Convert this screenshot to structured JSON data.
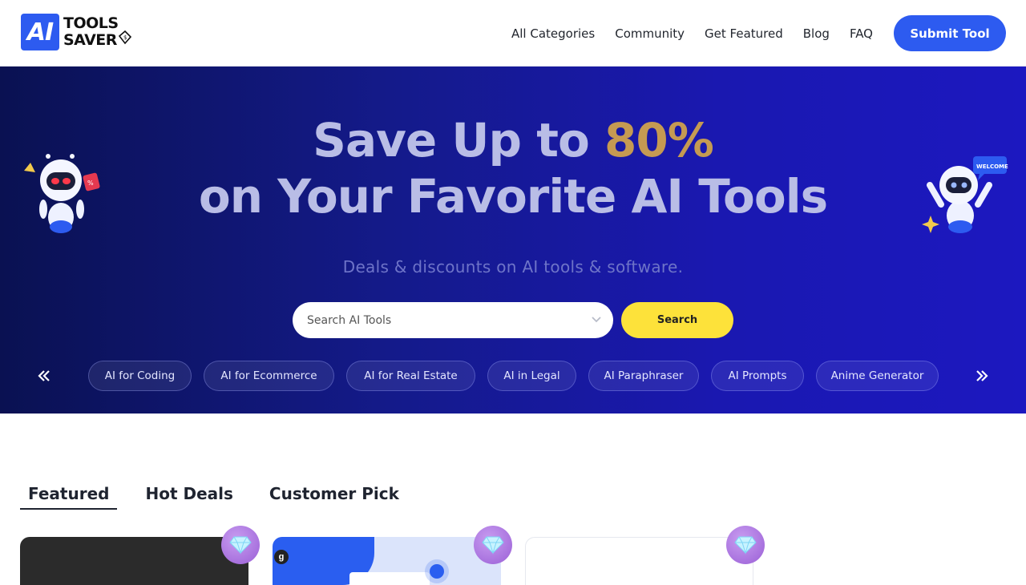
{
  "brand": {
    "badge": "AI",
    "line1": "TOOLS",
    "line2": "SAVER"
  },
  "nav": {
    "items": [
      "All Categories",
      "Community",
      "Get Featured",
      "Blog",
      "FAQ"
    ],
    "submit_label": "Submit Tool"
  },
  "hero": {
    "title_line1_prefix": "Save Up to ",
    "title_line1_accent": "80%",
    "title_line2": "on Your Favorite AI Tools",
    "subtitle": "Deals & discounts on AI tools & software.",
    "search_placeholder": "Search AI Tools",
    "search_button": "Search",
    "categories": [
      "AI for Coding",
      "AI for Ecommerce",
      "AI for Real Estate",
      "AI in Legal",
      "AI Paraphraser",
      "AI Prompts",
      "Anime Generator"
    ],
    "robot_sign": "WELCOME"
  },
  "tabs": [
    "Featured",
    "Hot Deals",
    "Customer Pick"
  ],
  "colors": {
    "primary": "#2d5bf0",
    "accent": "#c59a52",
    "search_button": "#fde23a"
  }
}
